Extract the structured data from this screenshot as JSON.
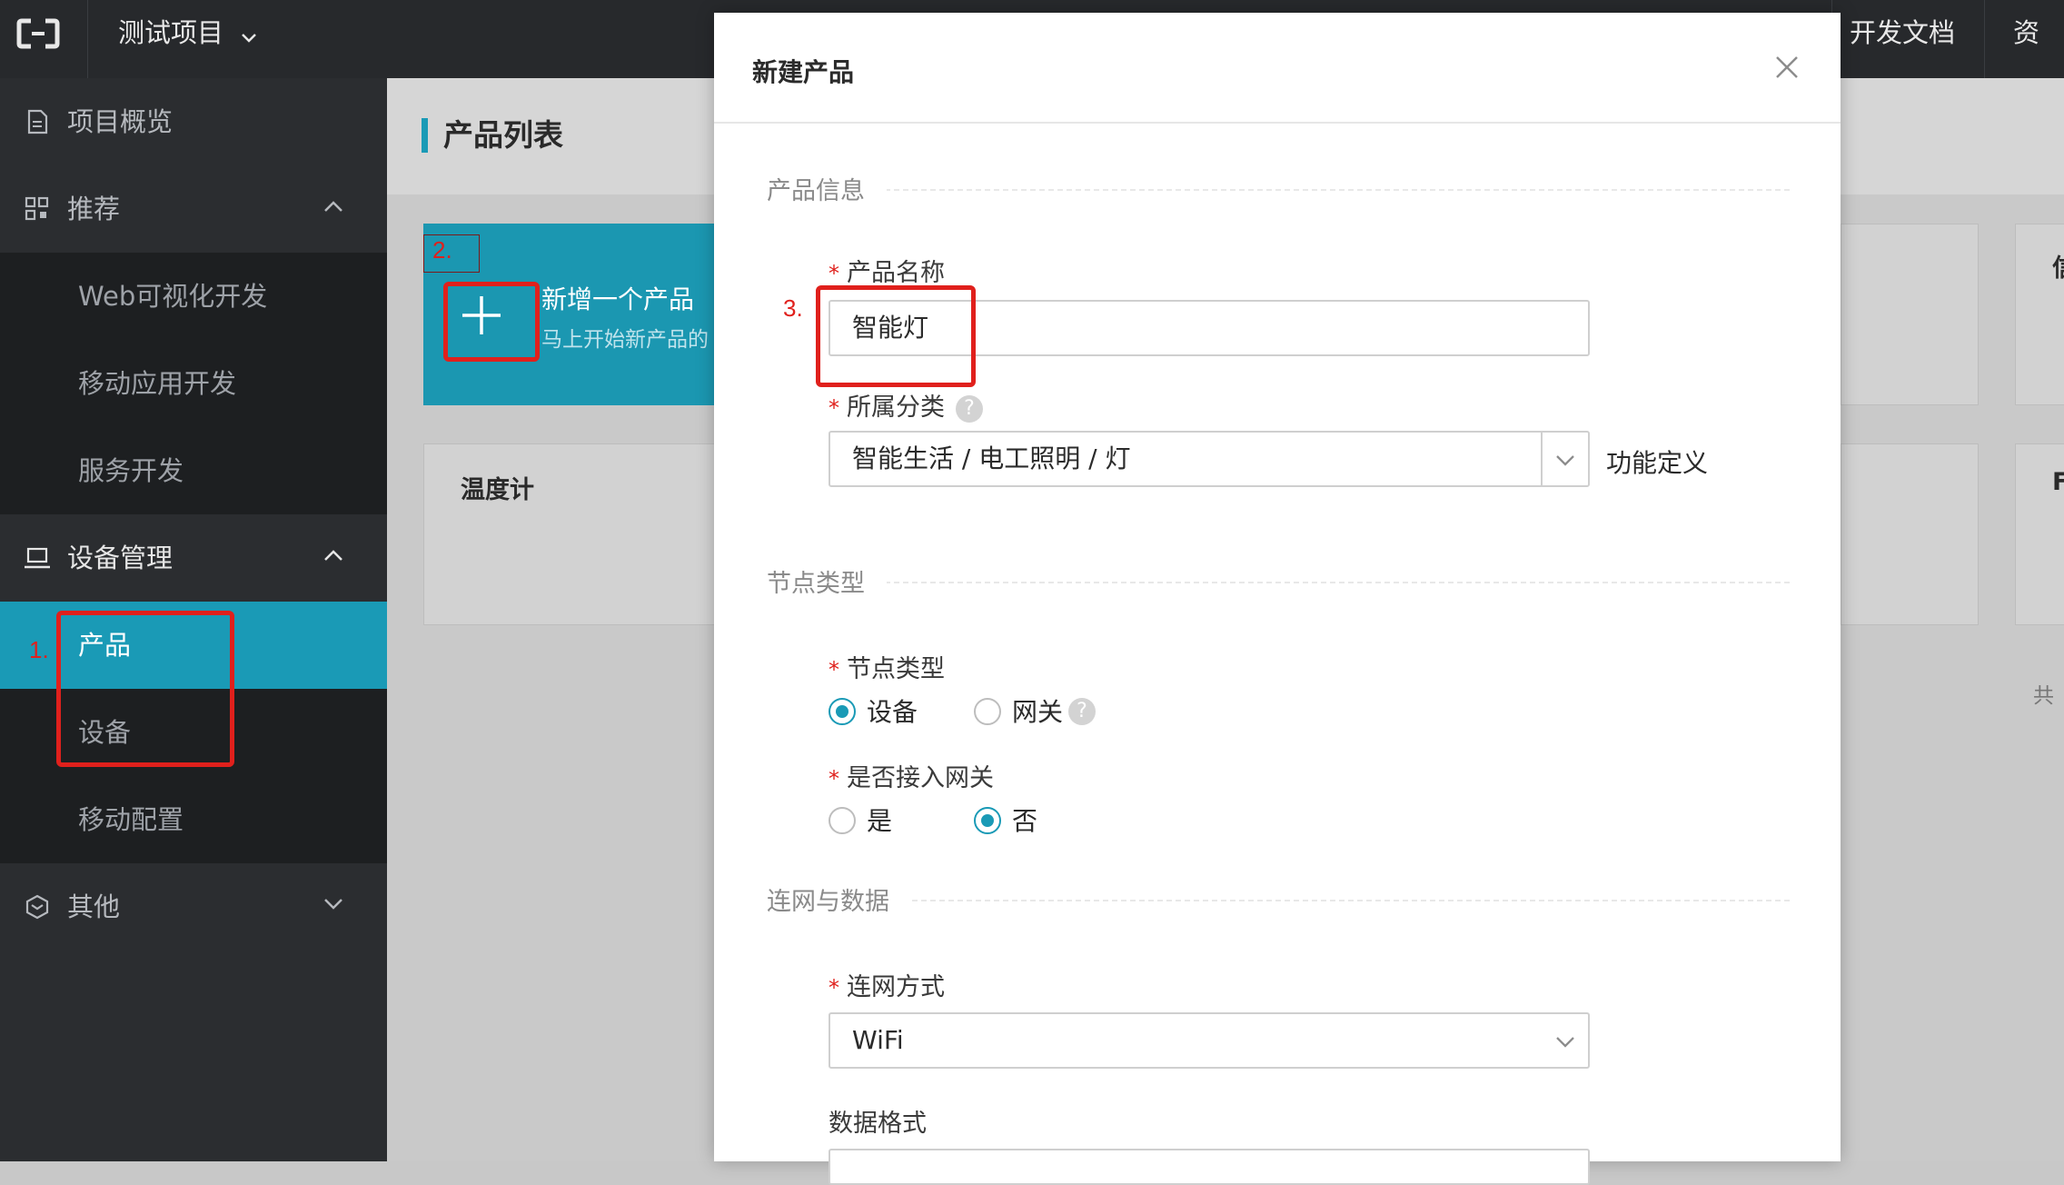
{
  "topbar": {
    "project_name": "测试项目",
    "right_links": [
      "开发文档",
      "资源"
    ]
  },
  "sidebar": {
    "items": [
      {
        "label": "项目概览",
        "icon": "document-icon"
      },
      {
        "label": "推荐",
        "icon": "grid-icon"
      },
      {
        "label": "设备管理",
        "icon": "laptop-icon"
      },
      {
        "label": "其他",
        "icon": "cube-icon"
      }
    ],
    "recommend_sub": [
      "Web可视化开发",
      "移动应用开发",
      "服务开发"
    ],
    "device_sub": [
      "产品",
      "设备",
      "移动配置"
    ],
    "active_item": "产品"
  },
  "annotations": {
    "step1": "1.",
    "step2": "2.",
    "step3": "3."
  },
  "main": {
    "page_title": "产品列表",
    "new_card_title": "新增一个产品",
    "new_card_subtitle": "马上开始新产品的",
    "product_card_name": "温度计",
    "right_edge_text_1": "信",
    "right_edge_text_2": "F",
    "right_edge_text_3": "共"
  },
  "modal": {
    "title": "新建产品",
    "section_product_info": "产品信息",
    "product_name_label": "产品名称",
    "product_name_value": "智能灯",
    "category_label": "所属分类",
    "category_value": "智能生活 / 电工照明 / 灯",
    "function_def_link": "功能定义",
    "section_node_type": "节点类型",
    "node_type_label": "节点类型",
    "node_type_options": [
      "设备",
      "网关"
    ],
    "node_type_selected": "设备",
    "gateway_label": "是否接入网关",
    "gateway_options": [
      "是",
      "否"
    ],
    "gateway_selected": "否",
    "section_network": "连网与数据",
    "network_label": "连网方式",
    "network_value": "WiFi",
    "data_format_label": "数据格式"
  },
  "colors": {
    "accent": "#1a9ab6",
    "annotation_red": "#e0201c",
    "sidebar_bg": "#2b2d30",
    "topbar_bg": "#27292c"
  }
}
